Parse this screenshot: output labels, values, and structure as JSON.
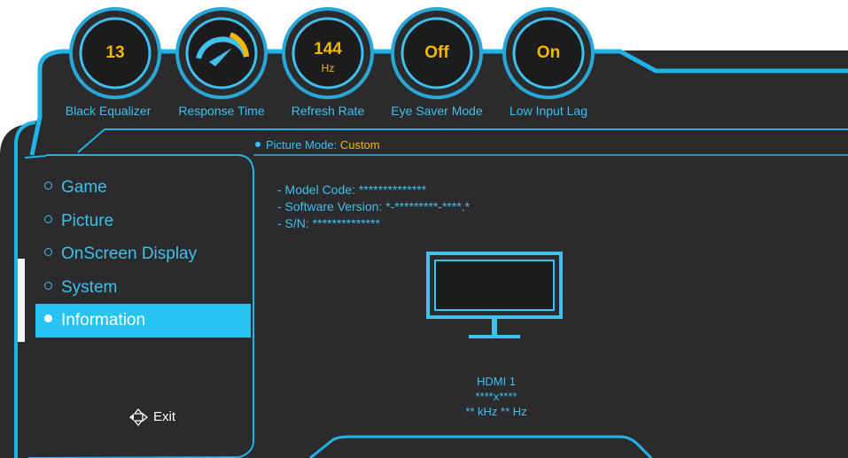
{
  "gauges": [
    {
      "value": "13",
      "unit": "",
      "label": "Black Equalizer"
    },
    {
      "value": "",
      "unit": "",
      "label": "Response Time",
      "icon": "speedometer-icon"
    },
    {
      "value": "144",
      "unit": "Hz",
      "label": "Refresh Rate"
    },
    {
      "value": "Off",
      "unit": "",
      "label": "Eye Saver Mode"
    },
    {
      "value": "On",
      "unit": "",
      "label": "Low Input Lag"
    }
  ],
  "picture_mode": {
    "label": "Picture Mode:",
    "value": "Custom"
  },
  "menu": {
    "items": [
      {
        "label": "Game"
      },
      {
        "label": "Picture"
      },
      {
        "label": "OnScreen Display"
      },
      {
        "label": "System"
      },
      {
        "label": "Information"
      }
    ],
    "selected": "Information"
  },
  "info": {
    "model_code": "- Model Code: **************",
    "software_version": "- Software Version: *-*********-****.*",
    "serial": "- S/N: **************"
  },
  "signal": {
    "input": "HDMI 1",
    "resolution": "****x****",
    "frequency": "** kHz ** Hz"
  },
  "footer": {
    "exit_label": "Exit",
    "icon": "navigation-arrows-icon"
  },
  "colors": {
    "accent": "#3fc1ee",
    "highlight": "#f5b800",
    "selected_bg": "#27c3f3",
    "panel_bg": "#2b2b2d",
    "border": "#22b3e6"
  }
}
